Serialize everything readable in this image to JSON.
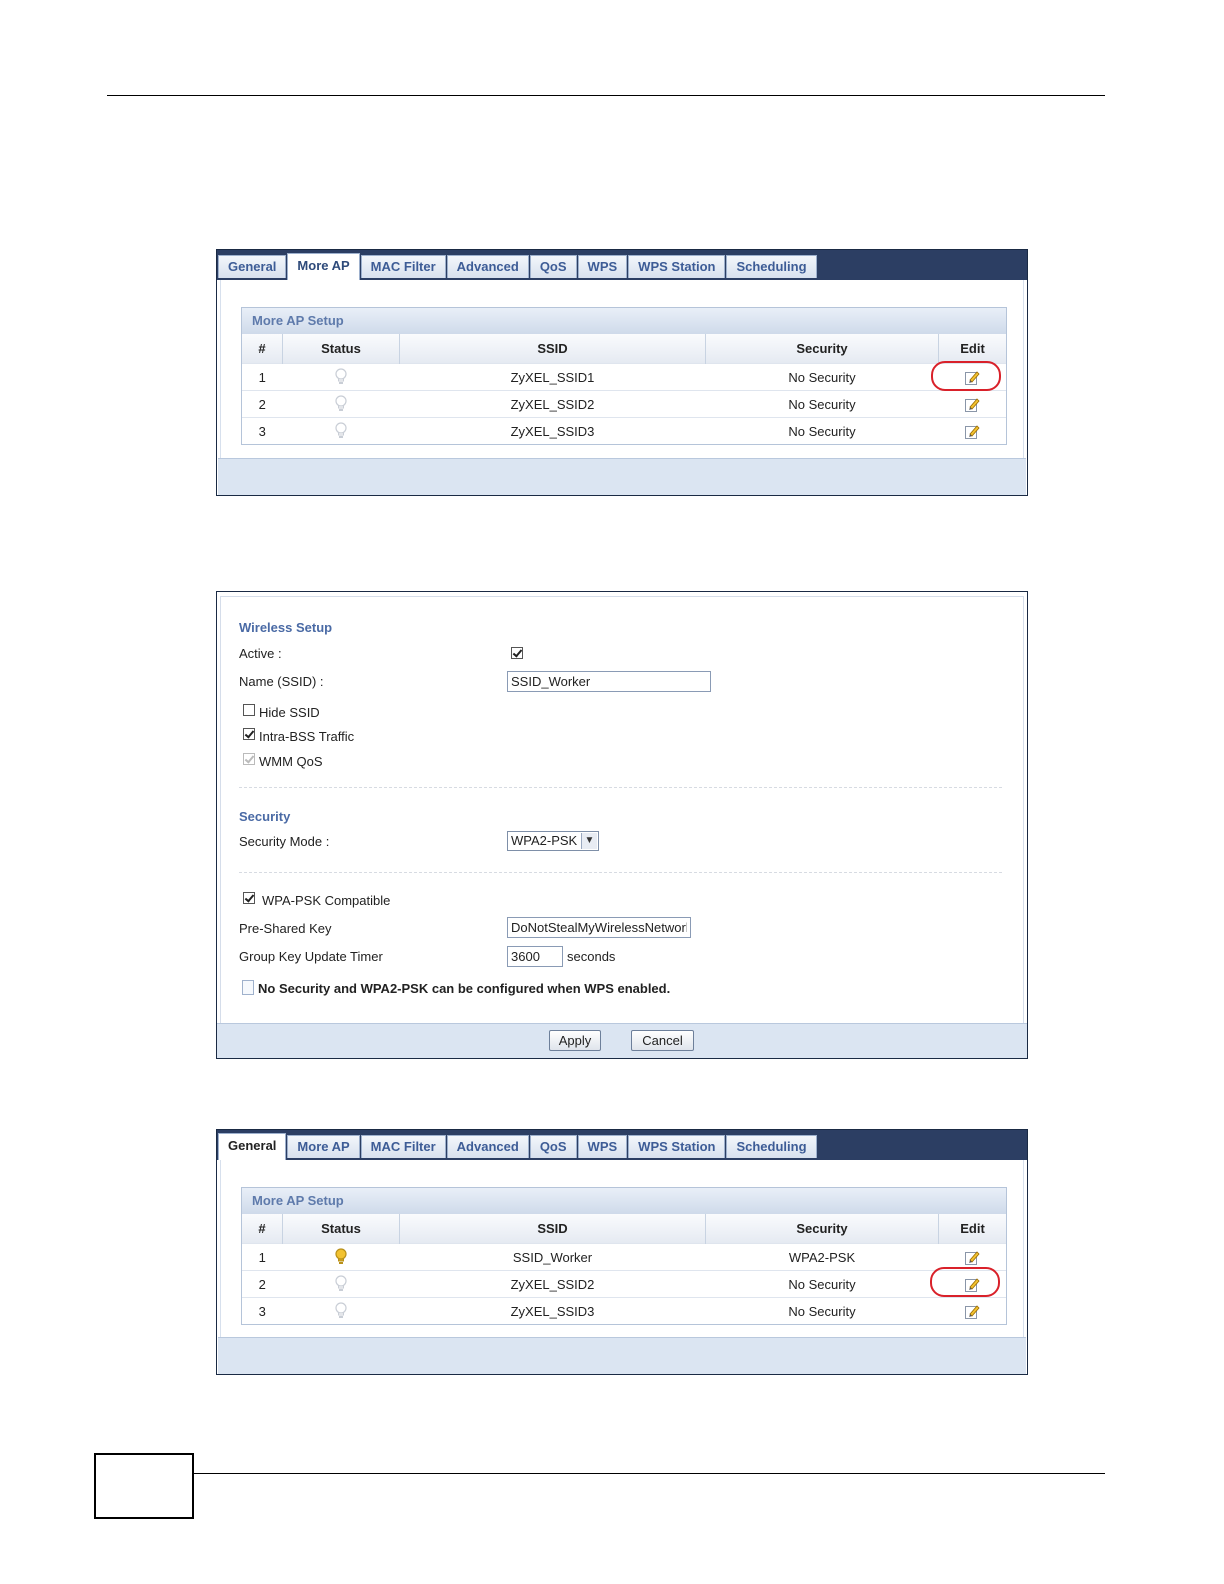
{
  "tabs": [
    "General",
    "More AP",
    "MAC Filter",
    "Advanced",
    "QoS",
    "WPS",
    "WPS Station",
    "Scheduling"
  ],
  "table_title": "More AP Setup",
  "columns": [
    "#",
    "Status",
    "SSID",
    "Security",
    "Edit"
  ],
  "panel1": {
    "active_tab": "More AP",
    "rows": [
      {
        "num": "1",
        "status": "off",
        "ssid": "ZyXEL_SSID1",
        "security": "No Security"
      },
      {
        "num": "2",
        "status": "off",
        "ssid": "ZyXEL_SSID2",
        "security": "No Security"
      },
      {
        "num": "3",
        "status": "off",
        "ssid": "ZyXEL_SSID3",
        "security": "No Security"
      }
    ],
    "highlighted_row": "1"
  },
  "form": {
    "wireless_setup_title": "Wireless Setup",
    "active_label": "Active :",
    "active_checked": true,
    "name_label": "Name (SSID) :",
    "name_value": "SSID_Worker",
    "hide_ssid_label": "Hide SSID",
    "hide_ssid_checked": false,
    "intra_bss_label": "Intra-BSS Traffic",
    "intra_bss_checked": true,
    "wmm_qos_label": "WMM QoS",
    "wmm_qos_checked": true,
    "wmm_qos_disabled": true,
    "security_title": "Security",
    "security_mode_label": "Security Mode :",
    "security_mode_value": "WPA2-PSK",
    "wpa_psk_compatible_label": "WPA-PSK Compatible",
    "wpa_psk_compatible_checked": true,
    "psk_label": "Pre-Shared Key",
    "psk_value": "DoNotStealMyWirelessNetwork",
    "group_key_label": "Group Key Update Timer",
    "group_key_value": "3600",
    "group_key_unit": "seconds",
    "note": "No Security and WPA2-PSK can be configured when WPS enabled.",
    "apply_label": "Apply",
    "cancel_label": "Cancel"
  },
  "panel3": {
    "active_tab": "General",
    "rows": [
      {
        "num": "1",
        "status": "on",
        "ssid": "SSID_Worker",
        "security": "WPA2-PSK"
      },
      {
        "num": "2",
        "status": "off",
        "ssid": "ZyXEL_SSID2",
        "security": "No Security"
      },
      {
        "num": "3",
        "status": "off",
        "ssid": "ZyXEL_SSID3",
        "security": "No Security"
      }
    ],
    "highlighted_row": "2"
  },
  "colors": {
    "tab_bar": "#2c3e63",
    "tab_text": "#3d5c96",
    "section_title": "#4a6aa5",
    "footer_band": "#dbe5f2",
    "highlight_ring": "#d9212a",
    "bulb_on": "#f2c230",
    "bulb_off": "#c9ced6"
  },
  "icons": {
    "status": "bulb-icon",
    "edit": "edit-pencil-icon",
    "note": "note-icon"
  }
}
